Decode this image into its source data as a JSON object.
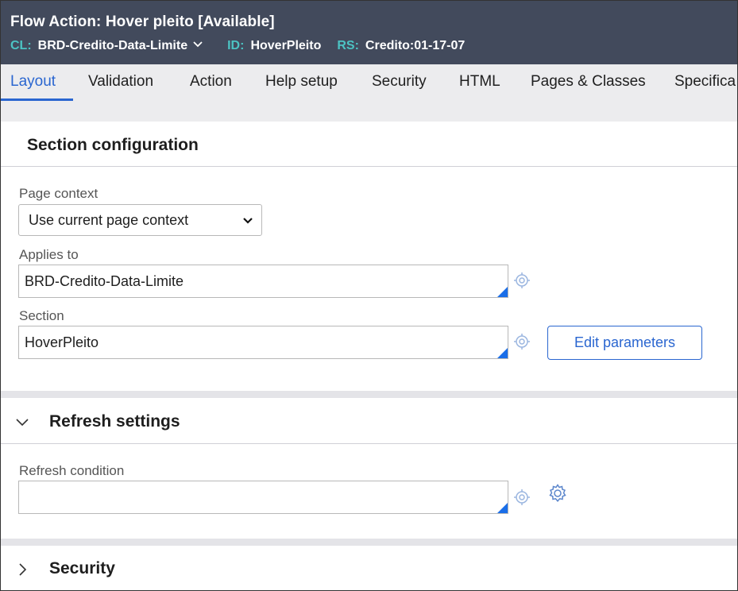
{
  "header": {
    "title": "Flow Action: Hover pleito [Available]",
    "cl_key": "CL:",
    "cl_value": "BRD-Credito-Data-Limite",
    "id_key": "ID:",
    "id_value": "HoverPleito",
    "rs_key": "RS:",
    "rs_value": "Credito:01-17-07"
  },
  "tabs": [
    {
      "label": "Layout",
      "active": true
    },
    {
      "label": "Validation"
    },
    {
      "label": "Action"
    },
    {
      "label": "Help setup"
    },
    {
      "label": "Security"
    },
    {
      "label": "HTML"
    },
    {
      "label": "Pages & Classes"
    },
    {
      "label": "Specifica"
    }
  ],
  "section_config": {
    "title": "Section configuration",
    "page_context_label": "Page context",
    "page_context_value": "Use current page context",
    "applies_to_label": "Applies to",
    "applies_to_value": "BRD-Credito-Data-Limite",
    "section_label": "Section",
    "section_value": "HoverPleito",
    "edit_params_label": "Edit parameters"
  },
  "refresh": {
    "title": "Refresh settings",
    "condition_label": "Refresh condition",
    "condition_value": ""
  },
  "security": {
    "title": "Security"
  },
  "colors": {
    "header_bg": "#424a5c",
    "header_key": "#4cc3c3",
    "accent": "#2a66d0",
    "tab_bar_bg": "#ececee",
    "field_corner": "#1a6ee8"
  }
}
